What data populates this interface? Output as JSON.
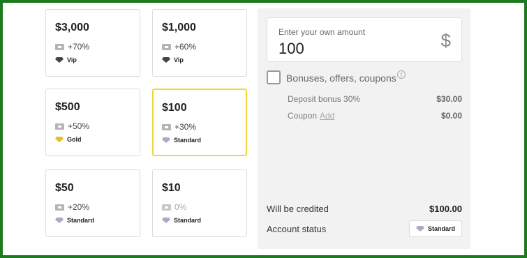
{
  "cards": [
    {
      "amount": "$3,000",
      "bonus": "+70%",
      "status": "Vip",
      "tier": "vip",
      "selected": false
    },
    {
      "amount": "$1,000",
      "bonus": "+60%",
      "status": "Vip",
      "tier": "vip",
      "selected": false
    },
    {
      "amount": "$500",
      "bonus": "+50%",
      "status": "Gold",
      "tier": "gold",
      "selected": false
    },
    {
      "amount": "$100",
      "bonus": "+30%",
      "status": "Standard",
      "tier": "standard",
      "selected": true
    },
    {
      "amount": "$50",
      "bonus": "+20%",
      "status": "Standard",
      "tier": "standard",
      "selected": false
    },
    {
      "amount": "$10",
      "bonus": "0%",
      "status": "Standard",
      "tier": "standard",
      "selected": false
    }
  ],
  "panel": {
    "input_label": "Enter your own amount",
    "input_value": "100",
    "currency": "$",
    "bonus_checkbox_label": "Bonuses, offers, coupons",
    "info_glyph": "!",
    "deposit_bonus_label": "Deposit bonus 30%",
    "deposit_bonus_value": "$30.00",
    "coupon_label": "Coupon",
    "coupon_link": "Add",
    "coupon_value": "$0.00",
    "credited_label": "Will be credited",
    "credited_value": "$100.00",
    "account_status_label": "Account status",
    "account_status_value": "Standard"
  },
  "colors": {
    "frame": "#1e7a1e",
    "selected_border": "#f0d53a",
    "gem_vip": "#444444",
    "gem_gold": "#e8c21a",
    "gem_standard": "#a9a9c9"
  }
}
